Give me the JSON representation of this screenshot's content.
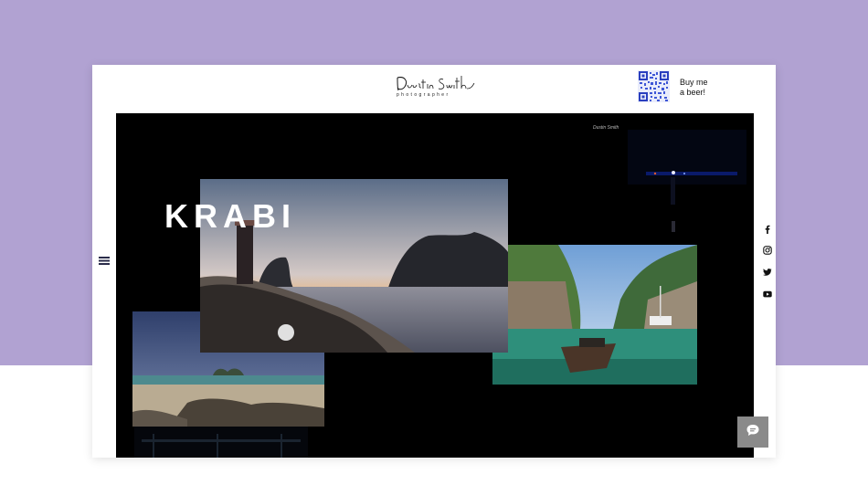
{
  "header": {
    "logo_text": "Dustin Smith",
    "logo_subtitle": "photographer",
    "donate_text_line1": "Buy me",
    "donate_text_line2": "a beer!"
  },
  "hero": {
    "title": "KRABI",
    "mini_logo": "Dustin Smith"
  },
  "icons": {
    "menu": "hamburger-menu-icon",
    "social": [
      "facebook-icon",
      "instagram-icon",
      "twitter-icon",
      "youtube-icon"
    ],
    "chat": "chat-icon"
  },
  "colors": {
    "background_top": "#b1a2d2",
    "stage": "#000000",
    "menu_icon": "#2a2c4a",
    "chat_button": "#8a8a8a"
  }
}
